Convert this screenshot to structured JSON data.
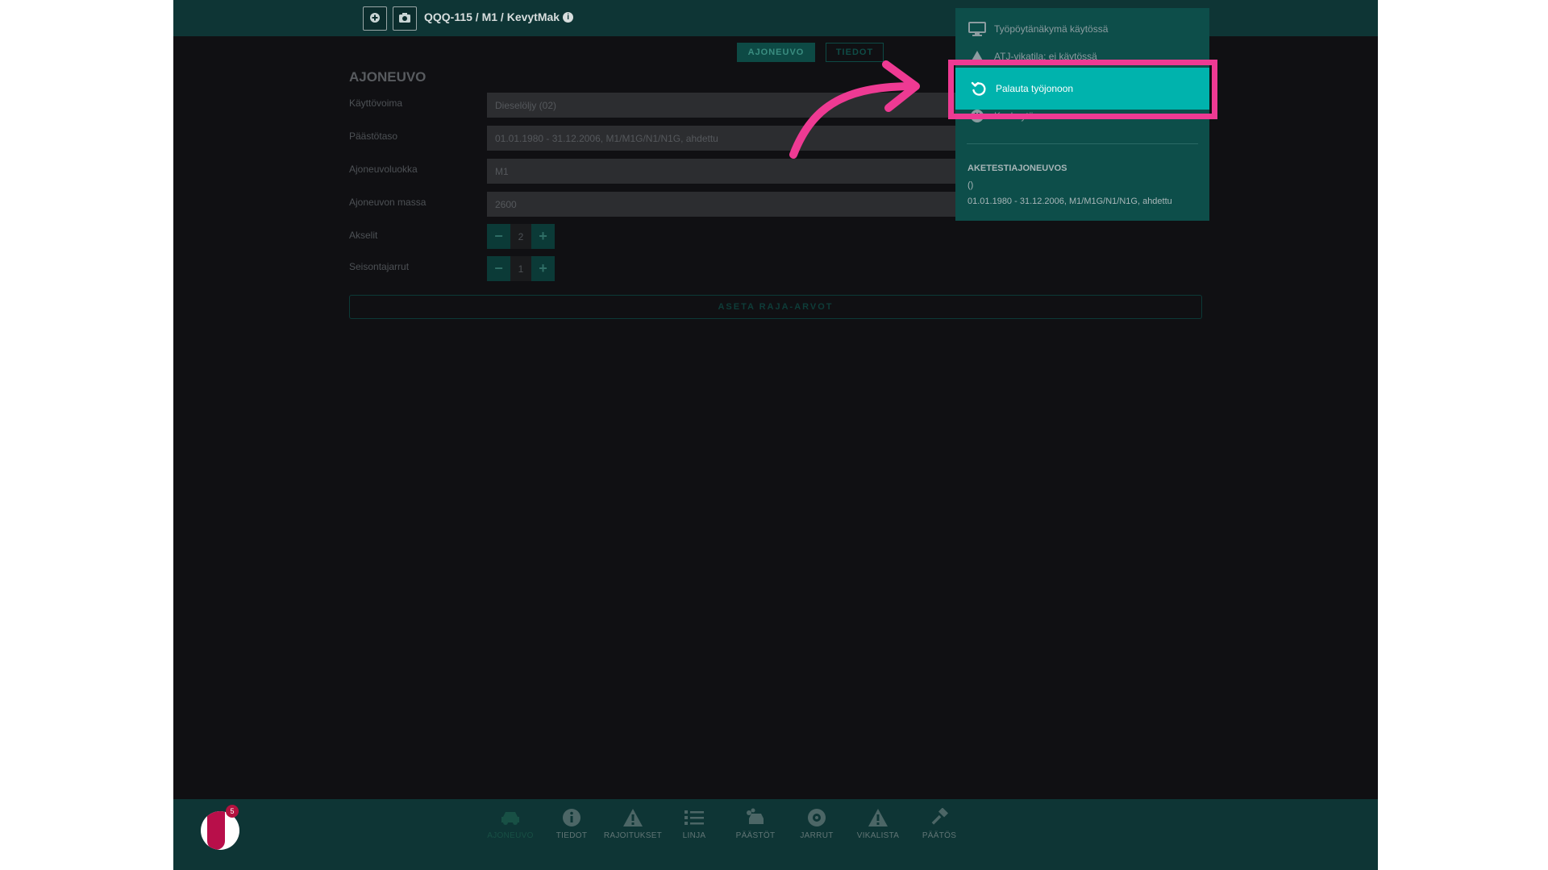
{
  "header": {
    "title": "QQQ-115 / M1 / KevytMak",
    "info_icon": "info-circle-icon",
    "buttons": [
      "add-icon",
      "camera-icon"
    ]
  },
  "tabs": [
    {
      "label": "AJONEUVO",
      "active": true
    },
    {
      "label": "TIEDOT",
      "active": false
    }
  ],
  "form": {
    "section_title": "AJONEUVO",
    "fields": [
      {
        "label": "Käyttövoima",
        "value": "Dieselöljy (02)"
      },
      {
        "label": "Päästötaso",
        "value": "01.01.1980 - 31.12.2006, M1/M1G/N1/N1G, ahdettu"
      },
      {
        "label": "Ajoneuvoluokka",
        "value": "M1"
      },
      {
        "label": "Ajoneuvon massa",
        "value": "2600"
      }
    ],
    "steppers": [
      {
        "label": "Akselit",
        "value": "2"
      },
      {
        "label": "Seisontajarrut",
        "value": "1"
      }
    ],
    "reset_label": "ASETA RAJA-ARVOT"
  },
  "menu": {
    "items": [
      {
        "label": "Työpöytänäkymä käytössä",
        "icon": "monitor-icon"
      },
      {
        "label": "ATJ-vikatila: ei käytössä",
        "icon": "warning-icon"
      },
      {
        "label": "Palauta työjonoon",
        "icon": "undo-icon",
        "highlighted": true
      },
      {
        "label": "Keskeytä",
        "icon": "pause-icon"
      }
    ],
    "info_heading": "AKETESTIAJONEUVOS",
    "info_line1": "()",
    "info_line2": "01.01.1980 - 31.12.2006, M1/M1G/N1/N1G, ahdettu"
  },
  "bottom_nav": {
    "badge_count": "5",
    "items": [
      {
        "label": "AJONEUVO",
        "icon": "car-icon",
        "active": true
      },
      {
        "label": "TIEDOT",
        "icon": "info-icon"
      },
      {
        "label": "RAJOITUKSET",
        "icon": "warning-icon"
      },
      {
        "label": "LINJA",
        "icon": "list-icon"
      },
      {
        "label": "PÄÄSTÖT",
        "icon": "exhaust-icon"
      },
      {
        "label": "JARRUT",
        "icon": "brake-icon"
      },
      {
        "label": "VIKALISTA",
        "icon": "warning-icon"
      },
      {
        "label": "PÄÄTÖS",
        "icon": "hammer-icon"
      }
    ]
  },
  "colors": {
    "accent": "#00b3ad",
    "highlight": "#ee3a93",
    "topbar": "#0e3535"
  }
}
